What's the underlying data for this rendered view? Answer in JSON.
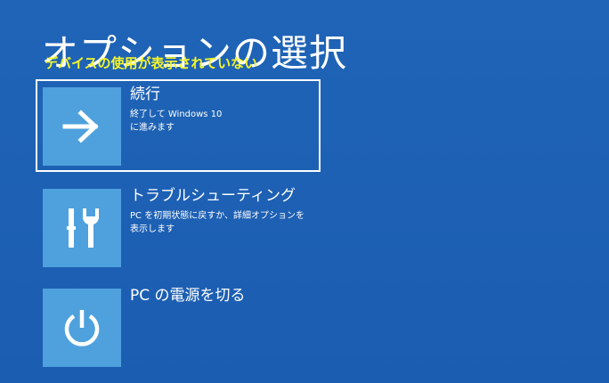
{
  "page": {
    "title": "オプションの選択",
    "annotation": "デバイスの使用が表示されていない"
  },
  "options": [
    {
      "label": "続行",
      "description_lines": [
        "終了して Windows 10",
        "に進みます"
      ],
      "icon": "arrow-right-icon"
    },
    {
      "label": "トラブルシューティング",
      "description_lines": [
        "PC を初期状態に戻すか、詳細オプションを",
        "表示します"
      ],
      "icon": "tools-icon"
    },
    {
      "label": "PC の電源を切る",
      "description_lines": [],
      "icon": "power-icon"
    }
  ],
  "colors": {
    "background": "#1f64b7",
    "tile": "#4ea1dd",
    "annotation": "#f5f52a",
    "text": "#ffffff"
  }
}
